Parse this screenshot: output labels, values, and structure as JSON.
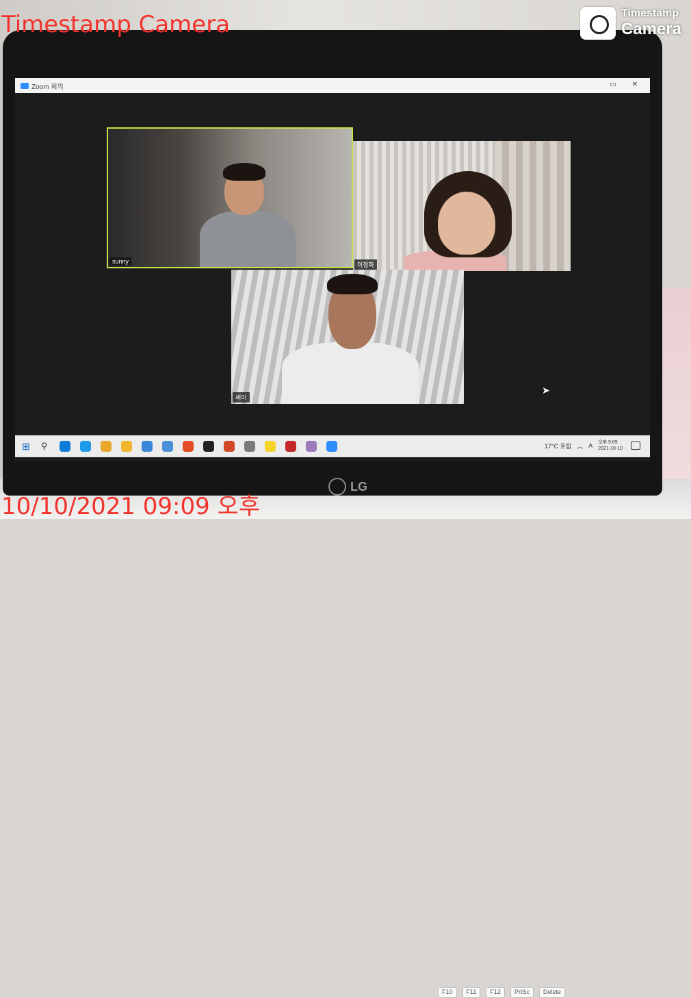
{
  "watermark": {
    "app_name_red": "Timestamp Camera",
    "date_time": "10/10/2021 09:09 오후",
    "badge_line1": "Timestamp",
    "badge_line2": "Camera"
  },
  "window": {
    "title": "Zoom 회의"
  },
  "participants": [
    {
      "name": "sunny",
      "active_speaker": true
    },
    {
      "name": "이정화",
      "active_speaker": false
    },
    {
      "name": "써이",
      "active_speaker": false
    }
  ],
  "taskbar": {
    "weather": "17°C 흐림",
    "ime_indicator": "A",
    "time": "오후 9:09",
    "date": "2021-10-10",
    "app_colors": [
      "#0f7ad8",
      "#1e9be8",
      "#e8a82b",
      "#f2b62c",
      "#3a86d8",
      "#4a90d8",
      "#e34c26",
      "#222222",
      "#d24726",
      "#7a7a7a",
      "#f6d329",
      "#c4282b",
      "#9a7ab8",
      "#2d8cff"
    ]
  },
  "laptop": {
    "brand": "LG"
  },
  "keyboard_keys": [
    "F10",
    "F11",
    "F12",
    "PrtSc",
    "Delete"
  ]
}
